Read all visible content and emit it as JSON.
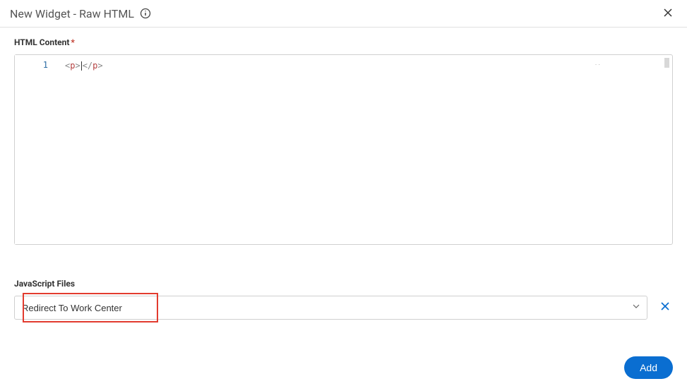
{
  "header": {
    "title": "New Widget - Raw HTML"
  },
  "htmlContent": {
    "label": "HTML Content",
    "lineNumber": "1",
    "open1": "<",
    "tag": "p",
    "close1": ">",
    "open2": "</",
    "close2": ">"
  },
  "jsFiles": {
    "label": "JavaScript Files",
    "selected": "Redirect To Work Center"
  },
  "footer": {
    "addLabel": "Add"
  }
}
